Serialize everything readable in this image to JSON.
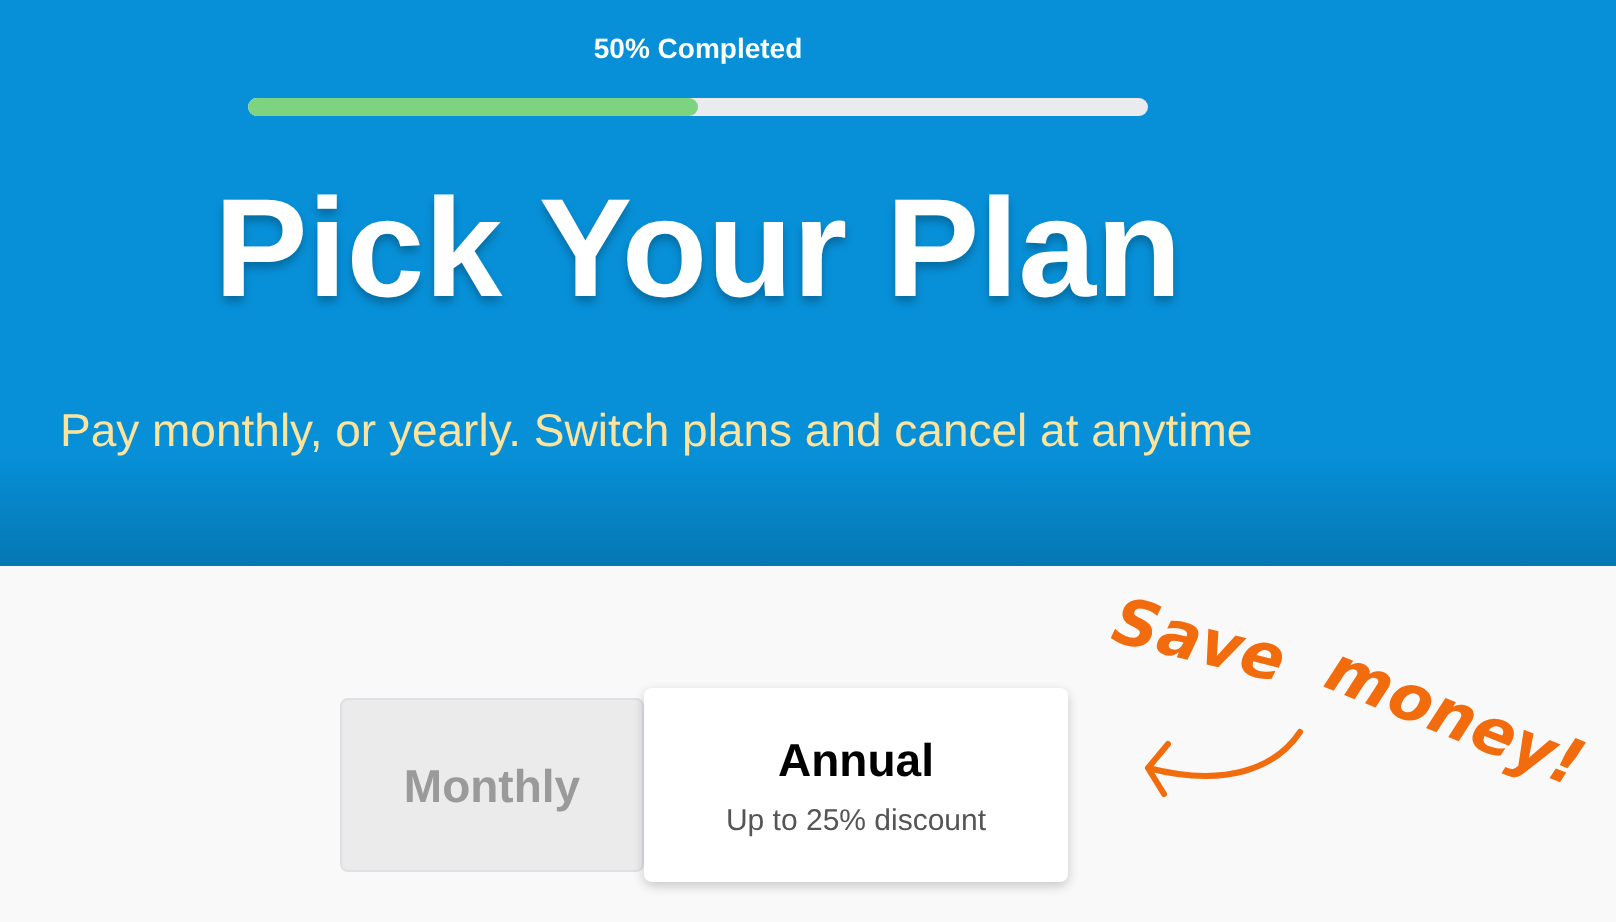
{
  "progress": {
    "label": "50% Completed",
    "level": 0.5
  },
  "title": "Pick Your Plan",
  "subtitle": "Pay monthly, or yearly. Switch plans and cancel at anytime",
  "plans": [
    {
      "name": "Monthly",
      "selected": false
    },
    {
      "name": "Annual",
      "note": "Up to 25% discount",
      "selected": true
    }
  ],
  "callout": [
    "Save",
    "money!"
  ]
}
